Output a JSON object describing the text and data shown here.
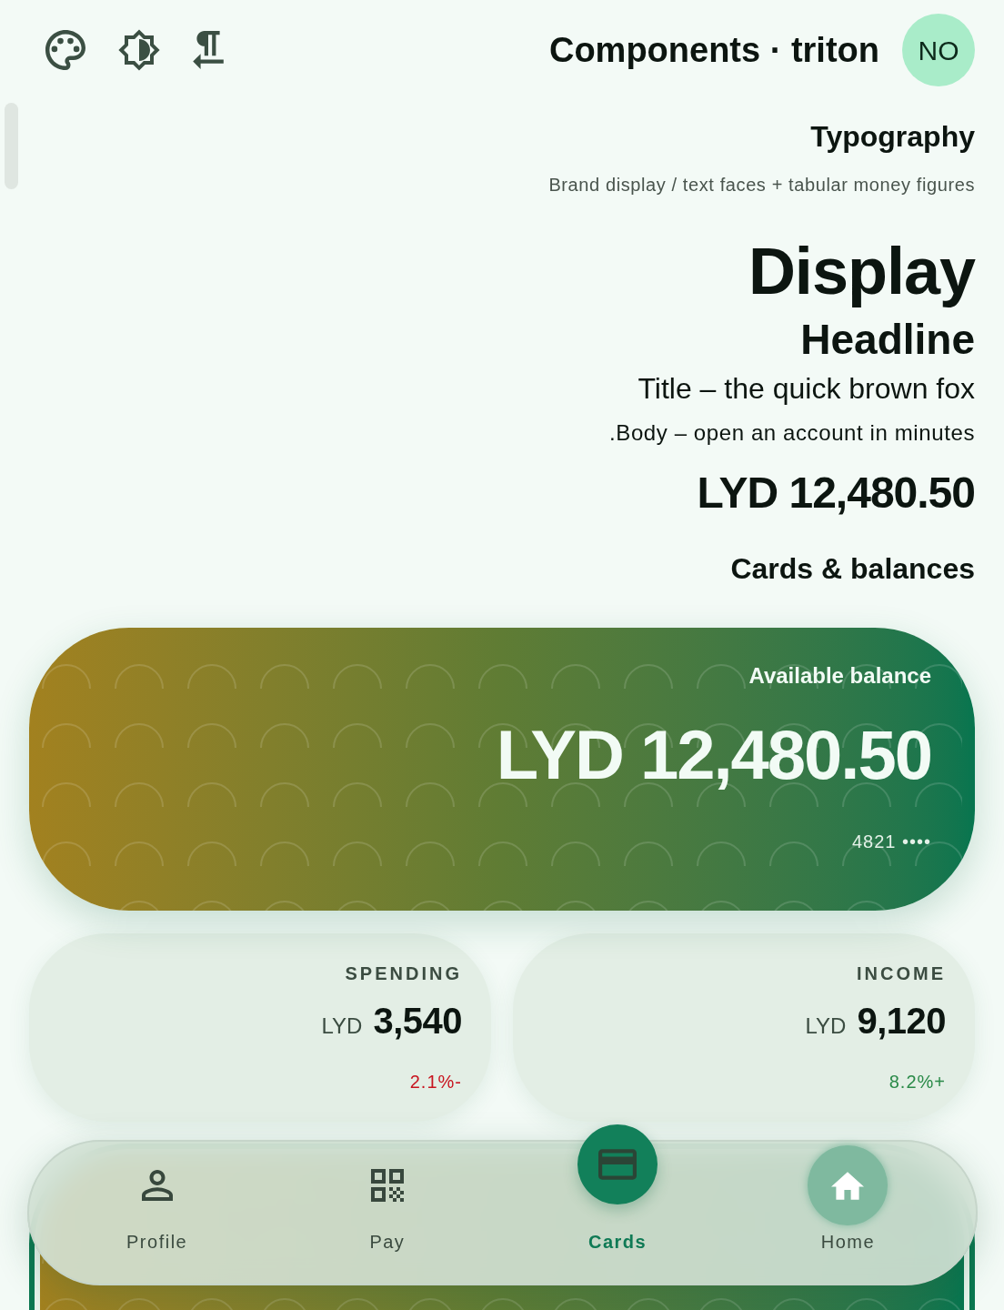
{
  "header": {
    "title": "Components · triton",
    "avatar": "NO"
  },
  "typography": {
    "heading": "Typography",
    "subtitle": "Brand display / text faces + tabular money figures",
    "samples": [
      {
        "kind": "display",
        "text": "Display"
      },
      {
        "kind": "headline",
        "text": "Headline"
      },
      {
        "kind": "title",
        "text": "Title – the quick brown fox"
      },
      {
        "kind": "body",
        "text": ".Body – open an account in minutes"
      },
      {
        "kind": "money",
        "text": "LYD 12,480.50"
      }
    ]
  },
  "cards_section": {
    "heading": "Cards & balances"
  },
  "balance_cards": [
    {
      "kind": "filled",
      "label": "Available balance",
      "amount": "LYD 12,480.50",
      "card_number": "4821 ••••"
    },
    {
      "kind": "outlined"
    }
  ],
  "stats": [
    {
      "label": "SPENDING",
      "currency": "LYD",
      "amount": "3,540",
      "change": "2.1%-",
      "color": "#c8141f"
    },
    {
      "label": "INCOME",
      "currency": "LYD",
      "amount": "9,120",
      "change": "8.2%+",
      "color": "#2a8a48"
    }
  ],
  "bottom_nav": [
    {
      "label": "Profile",
      "selected": false,
      "highlighted": false
    },
    {
      "label": "Pay",
      "selected": false,
      "highlighted": false
    },
    {
      "label": "Cards",
      "selected": true,
      "highlighted": false
    },
    {
      "label": "Home",
      "selected": false,
      "highlighted": true
    }
  ]
}
